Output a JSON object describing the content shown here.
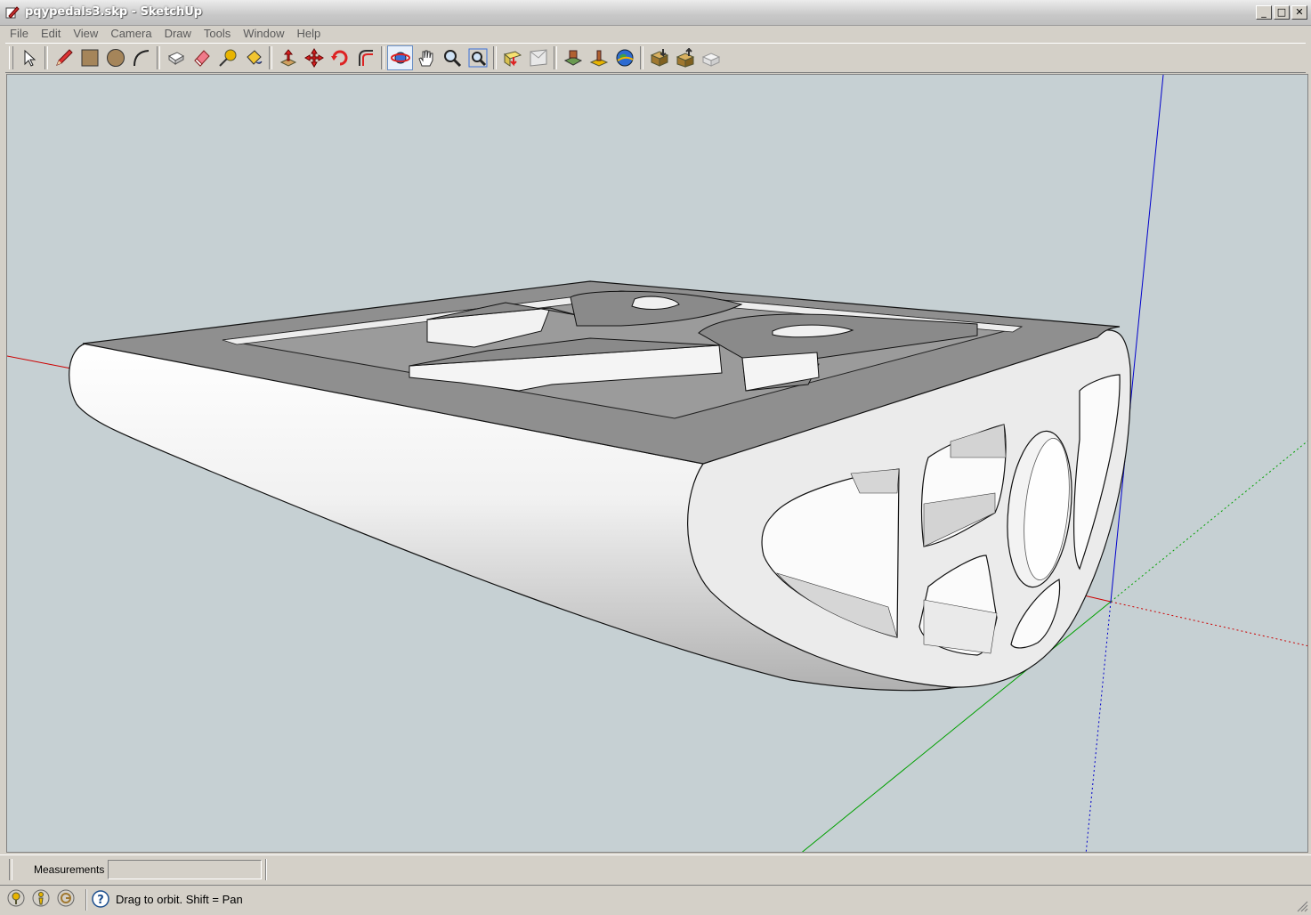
{
  "window": {
    "title": "pqypedals3.skp - SketchUp",
    "buttons": [
      "_",
      "□",
      "✕"
    ]
  },
  "menubar": {
    "items": [
      "File",
      "Edit",
      "View",
      "Camera",
      "Draw",
      "Tools",
      "Window",
      "Help"
    ]
  },
  "toolbar": {
    "tools": [
      {
        "name": "select-icon"
      },
      {
        "name": "pencil-icon"
      },
      {
        "name": "rectangle-icon"
      },
      {
        "name": "circle-icon"
      },
      {
        "name": "arc-icon"
      },
      {
        "name": "make-component-icon"
      },
      {
        "name": "eraser-icon"
      },
      {
        "name": "tape-measure-icon"
      },
      {
        "name": "paint-bucket-icon"
      },
      {
        "name": "push-pull-icon"
      },
      {
        "name": "move-icon"
      },
      {
        "name": "rotate-icon"
      },
      {
        "name": "follow-me-icon"
      },
      {
        "name": "orbit-icon"
      },
      {
        "name": "pan-icon"
      },
      {
        "name": "zoom-icon"
      },
      {
        "name": "zoom-extents-icon"
      },
      {
        "name": "previous-view-icon"
      },
      {
        "name": "next-view-icon"
      },
      {
        "name": "add-location-icon"
      },
      {
        "name": "toggle-terrain-icon"
      },
      {
        "name": "google-earth-icon"
      },
      {
        "name": "get-models-icon"
      },
      {
        "name": "share-model-icon"
      },
      {
        "name": "share-component-icon"
      }
    ],
    "active_tool": "orbit-icon"
  },
  "measurements": {
    "label": "Measurements",
    "value": ""
  },
  "status": {
    "message": "Drag to orbit.  Shift = Pan"
  },
  "colors": {
    "sky": "#c6d0d3",
    "top_face": "#8f8f8f",
    "white_face": "#f4f4f4",
    "axis_red": "#cc0000",
    "axis_green": "#00a000",
    "axis_blue": "#0000cc"
  }
}
